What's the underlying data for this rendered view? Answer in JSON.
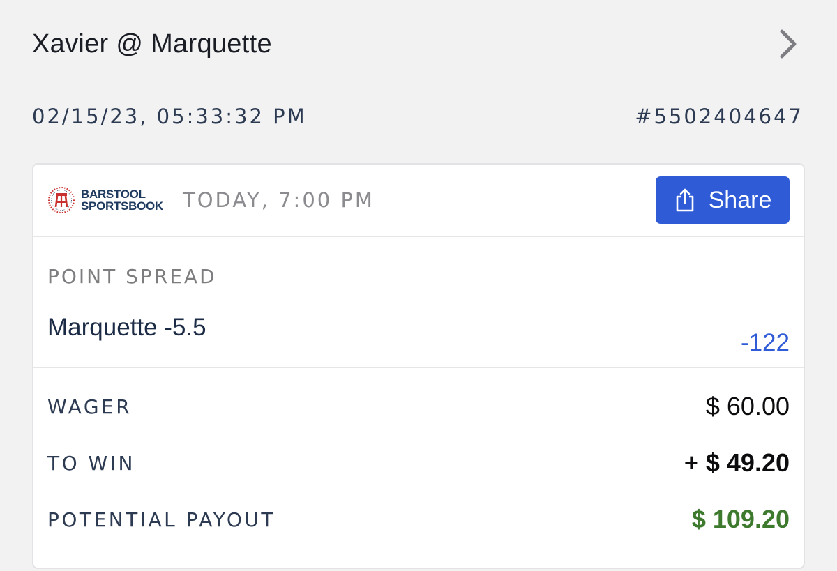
{
  "header": {
    "event_title": "Xavier @ Marquette",
    "chevron_icon": "chevron-right-icon"
  },
  "meta": {
    "placed_at": "02/15/23, 05:33:32 PM",
    "bet_id": "#5502404647"
  },
  "card": {
    "brand": {
      "line1": "BARSTOOL",
      "line2": "SPORTSBOOK",
      "icon": "barstool-seal-icon"
    },
    "event_time": "TODAY, 7:00 PM",
    "share_label": "Share",
    "share_icon": "share-icon",
    "market_label": "POINT SPREAD",
    "selection": "Marquette -5.5",
    "odds": "-122",
    "wager_label": "WAGER",
    "wager_value": "$ 60.00",
    "to_win_label": "TO WIN",
    "to_win_value": "+ $ 49.20",
    "payout_label": "POTENTIAL PAYOUT",
    "payout_value": "$ 109.20"
  },
  "colors": {
    "accent": "#2f5bd6",
    "payout_green": "#3d7a2e",
    "background": "#f2f2f3"
  }
}
